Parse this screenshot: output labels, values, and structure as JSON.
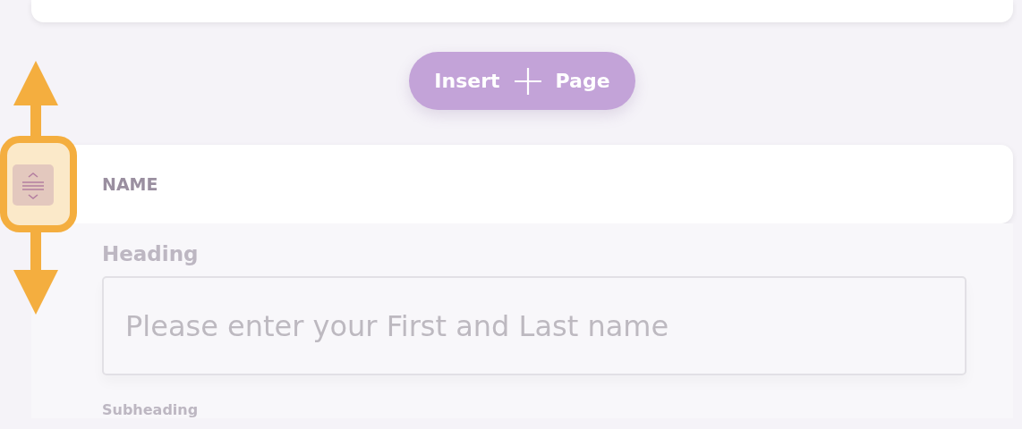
{
  "insert_button": {
    "label": "Insert",
    "second_label": "Page"
  },
  "section": {
    "title": "NAME",
    "heading_label": "Heading",
    "heading_field": {
      "placeholder": "Please enter your First and Last name"
    },
    "subheading_label": "Subheading"
  }
}
